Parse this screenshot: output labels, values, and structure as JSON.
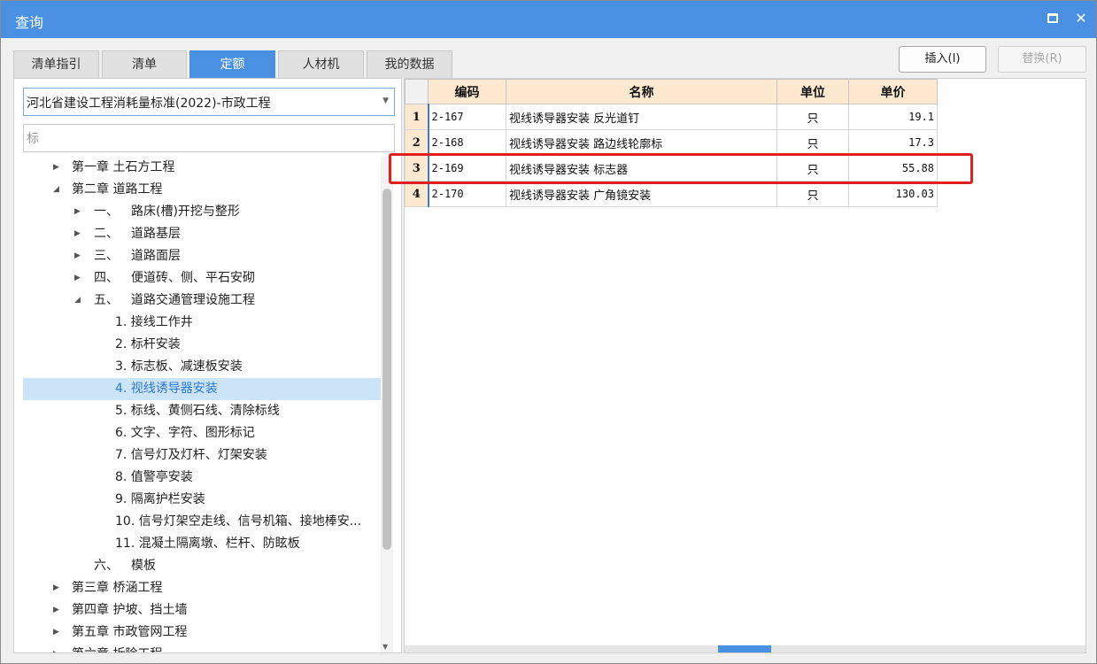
{
  "window": {
    "title": "查询"
  },
  "tabs": [
    {
      "label": "清单指引"
    },
    {
      "label": "清单"
    },
    {
      "label": "定额"
    },
    {
      "label": "人材机"
    },
    {
      "label": "我的数据"
    }
  ],
  "toolbar": {
    "insert_label": "插入(I)",
    "replace_label": "替换(R)"
  },
  "left": {
    "standard": "河北省建设工程消耗量标准(2022)-市政工程",
    "search_value": "标"
  },
  "tree": [
    {
      "label": "第一章 土石方工程"
    },
    {
      "label": "第二章 道路工程"
    },
    {
      "label": "一、",
      "text": "路床(槽)开挖与整形"
    },
    {
      "label": "二、",
      "text": "道路基层"
    },
    {
      "label": "三、",
      "text": "道路面层"
    },
    {
      "label": "四、",
      "text": "便道砖、侧、平石安砌"
    },
    {
      "label": "五、",
      "text": "道路交通管理设施工程"
    },
    {
      "label": "1. 接线工作井"
    },
    {
      "label": "2. 标杆安装"
    },
    {
      "label": "3. 标志板、减速板安装"
    },
    {
      "label": "4. 视线诱导器安装"
    },
    {
      "label": "5. 标线、黄侧石线、清除标线"
    },
    {
      "label": "6. 文字、字符、图形标记"
    },
    {
      "label": "7. 信号灯及灯杆、灯架安装"
    },
    {
      "label": "8. 值警亭安装"
    },
    {
      "label": "9. 隔离护栏安装"
    },
    {
      "label": "10. 信号灯架空走线、信号机箱、接地棒安..."
    },
    {
      "label": "11. 混凝土隔离墩、栏杆、防眩板"
    },
    {
      "label": "六、",
      "text": "模板"
    },
    {
      "label": "第三章 桥涵工程"
    },
    {
      "label": "第四章 护坡、挡土墙"
    },
    {
      "label": "第五章 市政管网工程"
    },
    {
      "label": "第六章 拆除工程"
    }
  ],
  "table": {
    "headers": {
      "code": "编码",
      "name": "名称",
      "unit": "单位",
      "price": "单价"
    },
    "rows": [
      {
        "num": "1",
        "code": "2-167",
        "name": "视线诱导器安装 反光道钉",
        "unit": "只",
        "price": "19.1"
      },
      {
        "num": "2",
        "code": "2-168",
        "name": "视线诱导器安装 路边线轮廓标",
        "unit": "只",
        "price": "17.3"
      },
      {
        "num": "3",
        "code": "2-169",
        "name": "视线诱导器安装 标志器",
        "unit": "只",
        "price": "55.88"
      },
      {
        "num": "4",
        "code": "2-170",
        "name": "视线诱导器安装 广角镜安装",
        "unit": "只",
        "price": "130.03"
      }
    ]
  },
  "colors": {
    "accent": "#4a90e2",
    "header_bg": "#fde9cf",
    "selected_bg": "#cce4f7",
    "highlight": "#e02020"
  }
}
